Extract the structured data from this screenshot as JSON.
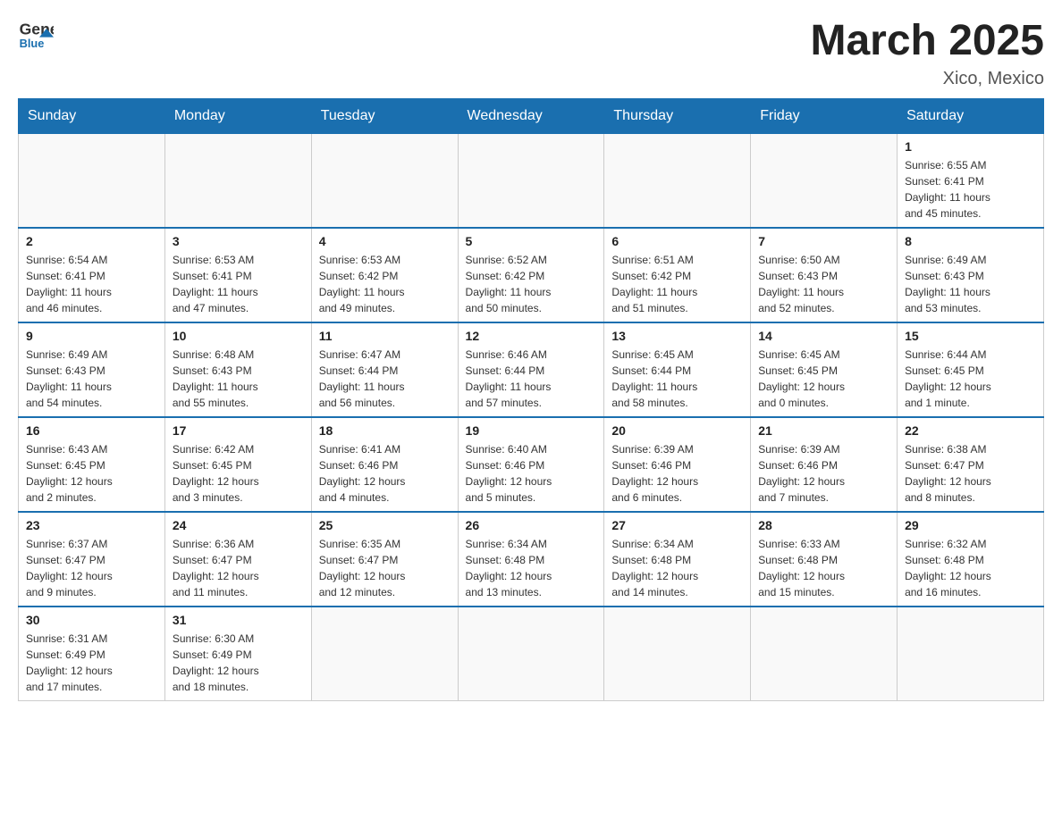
{
  "header": {
    "logo": {
      "line1": "General",
      "line2": "Blue"
    },
    "title": "March 2025",
    "location": "Xico, Mexico"
  },
  "days_of_week": [
    "Sunday",
    "Monday",
    "Tuesday",
    "Wednesday",
    "Thursday",
    "Friday",
    "Saturday"
  ],
  "weeks": [
    [
      {
        "day": "",
        "info": ""
      },
      {
        "day": "",
        "info": ""
      },
      {
        "day": "",
        "info": ""
      },
      {
        "day": "",
        "info": ""
      },
      {
        "day": "",
        "info": ""
      },
      {
        "day": "",
        "info": ""
      },
      {
        "day": "1",
        "info": "Sunrise: 6:55 AM\nSunset: 6:41 PM\nDaylight: 11 hours\nand 45 minutes."
      }
    ],
    [
      {
        "day": "2",
        "info": "Sunrise: 6:54 AM\nSunset: 6:41 PM\nDaylight: 11 hours\nand 46 minutes."
      },
      {
        "day": "3",
        "info": "Sunrise: 6:53 AM\nSunset: 6:41 PM\nDaylight: 11 hours\nand 47 minutes."
      },
      {
        "day": "4",
        "info": "Sunrise: 6:53 AM\nSunset: 6:42 PM\nDaylight: 11 hours\nand 49 minutes."
      },
      {
        "day": "5",
        "info": "Sunrise: 6:52 AM\nSunset: 6:42 PM\nDaylight: 11 hours\nand 50 minutes."
      },
      {
        "day": "6",
        "info": "Sunrise: 6:51 AM\nSunset: 6:42 PM\nDaylight: 11 hours\nand 51 minutes."
      },
      {
        "day": "7",
        "info": "Sunrise: 6:50 AM\nSunset: 6:43 PM\nDaylight: 11 hours\nand 52 minutes."
      },
      {
        "day": "8",
        "info": "Sunrise: 6:49 AM\nSunset: 6:43 PM\nDaylight: 11 hours\nand 53 minutes."
      }
    ],
    [
      {
        "day": "9",
        "info": "Sunrise: 6:49 AM\nSunset: 6:43 PM\nDaylight: 11 hours\nand 54 minutes."
      },
      {
        "day": "10",
        "info": "Sunrise: 6:48 AM\nSunset: 6:43 PM\nDaylight: 11 hours\nand 55 minutes."
      },
      {
        "day": "11",
        "info": "Sunrise: 6:47 AM\nSunset: 6:44 PM\nDaylight: 11 hours\nand 56 minutes."
      },
      {
        "day": "12",
        "info": "Sunrise: 6:46 AM\nSunset: 6:44 PM\nDaylight: 11 hours\nand 57 minutes."
      },
      {
        "day": "13",
        "info": "Sunrise: 6:45 AM\nSunset: 6:44 PM\nDaylight: 11 hours\nand 58 minutes."
      },
      {
        "day": "14",
        "info": "Sunrise: 6:45 AM\nSunset: 6:45 PM\nDaylight: 12 hours\nand 0 minutes."
      },
      {
        "day": "15",
        "info": "Sunrise: 6:44 AM\nSunset: 6:45 PM\nDaylight: 12 hours\nand 1 minute."
      }
    ],
    [
      {
        "day": "16",
        "info": "Sunrise: 6:43 AM\nSunset: 6:45 PM\nDaylight: 12 hours\nand 2 minutes."
      },
      {
        "day": "17",
        "info": "Sunrise: 6:42 AM\nSunset: 6:45 PM\nDaylight: 12 hours\nand 3 minutes."
      },
      {
        "day": "18",
        "info": "Sunrise: 6:41 AM\nSunset: 6:46 PM\nDaylight: 12 hours\nand 4 minutes."
      },
      {
        "day": "19",
        "info": "Sunrise: 6:40 AM\nSunset: 6:46 PM\nDaylight: 12 hours\nand 5 minutes."
      },
      {
        "day": "20",
        "info": "Sunrise: 6:39 AM\nSunset: 6:46 PM\nDaylight: 12 hours\nand 6 minutes."
      },
      {
        "day": "21",
        "info": "Sunrise: 6:39 AM\nSunset: 6:46 PM\nDaylight: 12 hours\nand 7 minutes."
      },
      {
        "day": "22",
        "info": "Sunrise: 6:38 AM\nSunset: 6:47 PM\nDaylight: 12 hours\nand 8 minutes."
      }
    ],
    [
      {
        "day": "23",
        "info": "Sunrise: 6:37 AM\nSunset: 6:47 PM\nDaylight: 12 hours\nand 9 minutes."
      },
      {
        "day": "24",
        "info": "Sunrise: 6:36 AM\nSunset: 6:47 PM\nDaylight: 12 hours\nand 11 minutes."
      },
      {
        "day": "25",
        "info": "Sunrise: 6:35 AM\nSunset: 6:47 PM\nDaylight: 12 hours\nand 12 minutes."
      },
      {
        "day": "26",
        "info": "Sunrise: 6:34 AM\nSunset: 6:48 PM\nDaylight: 12 hours\nand 13 minutes."
      },
      {
        "day": "27",
        "info": "Sunrise: 6:34 AM\nSunset: 6:48 PM\nDaylight: 12 hours\nand 14 minutes."
      },
      {
        "day": "28",
        "info": "Sunrise: 6:33 AM\nSunset: 6:48 PM\nDaylight: 12 hours\nand 15 minutes."
      },
      {
        "day": "29",
        "info": "Sunrise: 6:32 AM\nSunset: 6:48 PM\nDaylight: 12 hours\nand 16 minutes."
      }
    ],
    [
      {
        "day": "30",
        "info": "Sunrise: 6:31 AM\nSunset: 6:49 PM\nDaylight: 12 hours\nand 17 minutes."
      },
      {
        "day": "31",
        "info": "Sunrise: 6:30 AM\nSunset: 6:49 PM\nDaylight: 12 hours\nand 18 minutes."
      },
      {
        "day": "",
        "info": ""
      },
      {
        "day": "",
        "info": ""
      },
      {
        "day": "",
        "info": ""
      },
      {
        "day": "",
        "info": ""
      },
      {
        "day": "",
        "info": ""
      }
    ]
  ]
}
